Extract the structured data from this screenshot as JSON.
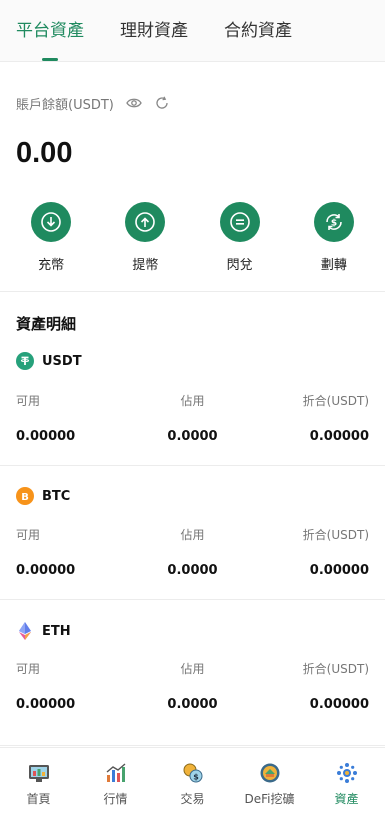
{
  "tabs": [
    {
      "label": "平台資產",
      "active": true
    },
    {
      "label": "理財資產",
      "active": false
    },
    {
      "label": "合約資產",
      "active": false
    }
  ],
  "balance": {
    "label": "賬戶餘額(USDT)",
    "amount": "0.00"
  },
  "actions": [
    {
      "label": "充幣",
      "icon": "deposit-icon"
    },
    {
      "label": "提幣",
      "icon": "withdraw-icon"
    },
    {
      "label": "閃兌",
      "icon": "swap-icon"
    },
    {
      "label": "劃轉",
      "icon": "transfer-icon"
    }
  ],
  "details_title": "資產明細",
  "column_headers": [
    "可用",
    "佔用",
    "折合(USDT)"
  ],
  "assets": [
    {
      "name": "USDT",
      "available": "0.00000",
      "occupied": "0.0000",
      "equivalent": "0.00000",
      "icon": "usdt-icon",
      "color": "#26a17b"
    },
    {
      "name": "BTC",
      "available": "0.00000",
      "occupied": "0.0000",
      "equivalent": "0.00000",
      "icon": "btc-icon",
      "color": "#f7931a"
    },
    {
      "name": "ETH",
      "available": "0.00000",
      "occupied": "0.0000",
      "equivalent": "0.00000",
      "icon": "eth-icon",
      "color": "#627eea"
    }
  ],
  "nav": [
    {
      "label": "首頁",
      "icon": "home-icon",
      "active": false
    },
    {
      "label": "行情",
      "icon": "market-icon",
      "active": false
    },
    {
      "label": "交易",
      "icon": "trade-icon",
      "active": false
    },
    {
      "label": "DeFi挖礦",
      "icon": "defi-mining-icon",
      "active": false
    },
    {
      "label": "資產",
      "icon": "assets-icon",
      "active": true
    }
  ],
  "colors": {
    "accent": "#1f8a5f"
  }
}
